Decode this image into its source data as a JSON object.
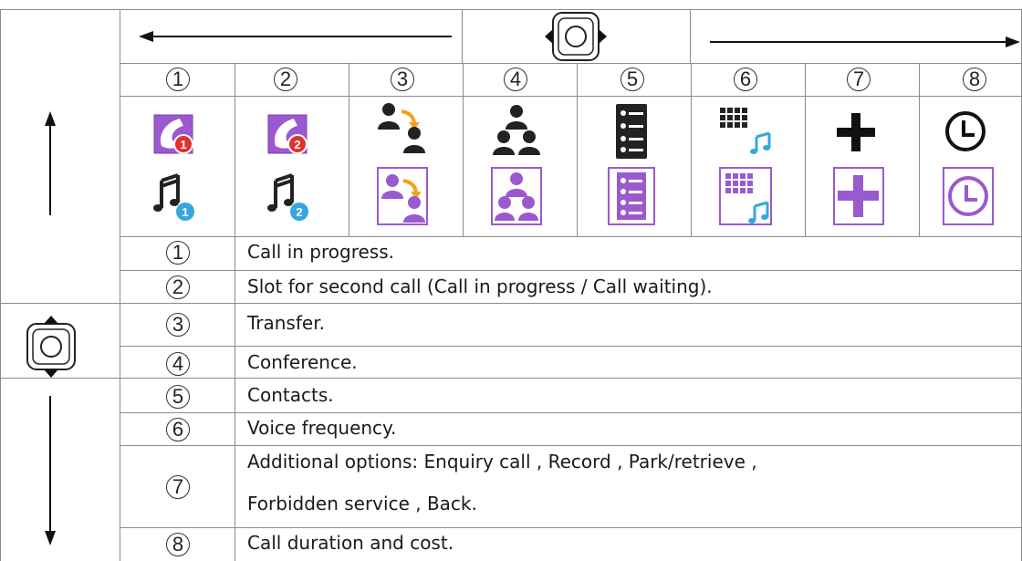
{
  "table_header": {
    "slot_numbers": [
      "1",
      "2",
      "3",
      "4",
      "5",
      "6",
      "7",
      "8"
    ]
  },
  "icons": [
    "call-in-progress-icon",
    "second-call-icon",
    "transfer-icon",
    "conference-icon",
    "contacts-icon",
    "voice-frequency-icon",
    "additional-options-icon",
    "call-duration-icon"
  ],
  "legend": [
    {
      "num": "1",
      "text": "Call in progress."
    },
    {
      "num": "2",
      "text": "Slot for second call (Call in progress / Call waiting)."
    },
    {
      "num": "3",
      "text": "Transfer."
    },
    {
      "num": "4",
      "text": "Conference."
    },
    {
      "num": "5",
      "text": "Contacts."
    },
    {
      "num": "6",
      "text": "Voice frequency."
    },
    {
      "num": "7",
      "text": "Additional options: Enquiry call , Record , Park/retrieve ,",
      "text2": "Forbidden service , Back."
    },
    {
      "num": "8",
      "text": "Call duration and cost."
    }
  ],
  "colors": {
    "highlight": "#9b59d0",
    "badge_red": "#e0322d",
    "badge_blue": "#35a7da",
    "arrow_orange": "#f2a21a",
    "grid": "#8c8c8c"
  }
}
